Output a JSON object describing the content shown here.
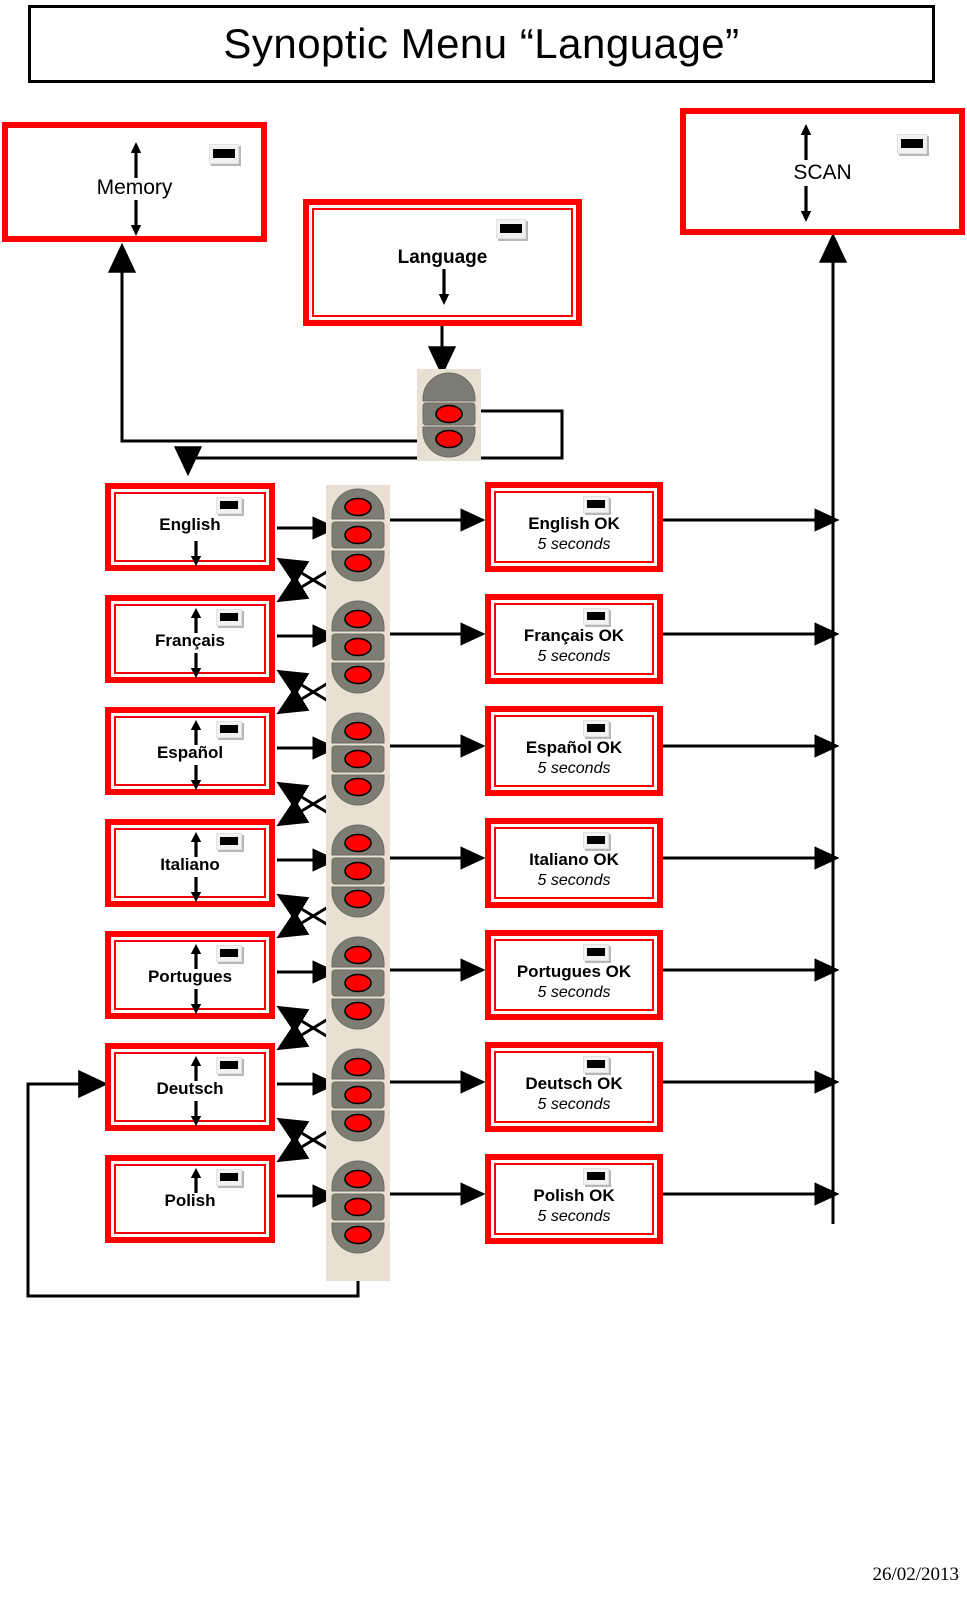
{
  "title": "Synoptic Menu “Language”",
  "date": "26/02/2013",
  "icons": {
    "lcd": "lcd-display-icon",
    "arrow_up": "arrow-up-icon",
    "arrow_down": "arrow-down-icon",
    "remote_button": "remote-button-widget"
  },
  "top": {
    "memory": {
      "label": "Memory"
    },
    "scan": {
      "label": "SCAN"
    },
    "language": {
      "label": "Language"
    }
  },
  "languages": [
    {
      "name": "English",
      "ok": "English OK",
      "duration": "5  seconds",
      "up": false,
      "down": true
    },
    {
      "name": "Français",
      "ok": "Français OK",
      "duration": "5  seconds",
      "up": true,
      "down": true
    },
    {
      "name": "Español",
      "ok": "Español OK",
      "duration": "5  seconds",
      "up": true,
      "down": true
    },
    {
      "name": "Italiano",
      "ok": "Italiano OK",
      "duration": "5  seconds",
      "up": true,
      "down": true
    },
    {
      "name": "Portugues",
      "ok": "Portugues OK",
      "duration": "5  seconds",
      "up": true,
      "down": true
    },
    {
      "name": "Deutsch",
      "ok": "Deutsch OK",
      "duration": "5  seconds",
      "up": true,
      "down": true
    },
    {
      "name": "Polish",
      "ok": "Polish OK",
      "duration": "5  seconds",
      "up": true,
      "down": false
    }
  ],
  "colors": {
    "accent_red": "#ff0000",
    "text_black": "#000000",
    "button_gray": "#7d7d73",
    "button_bg": "#e8e0d2",
    "lcd_black": "#000000"
  }
}
